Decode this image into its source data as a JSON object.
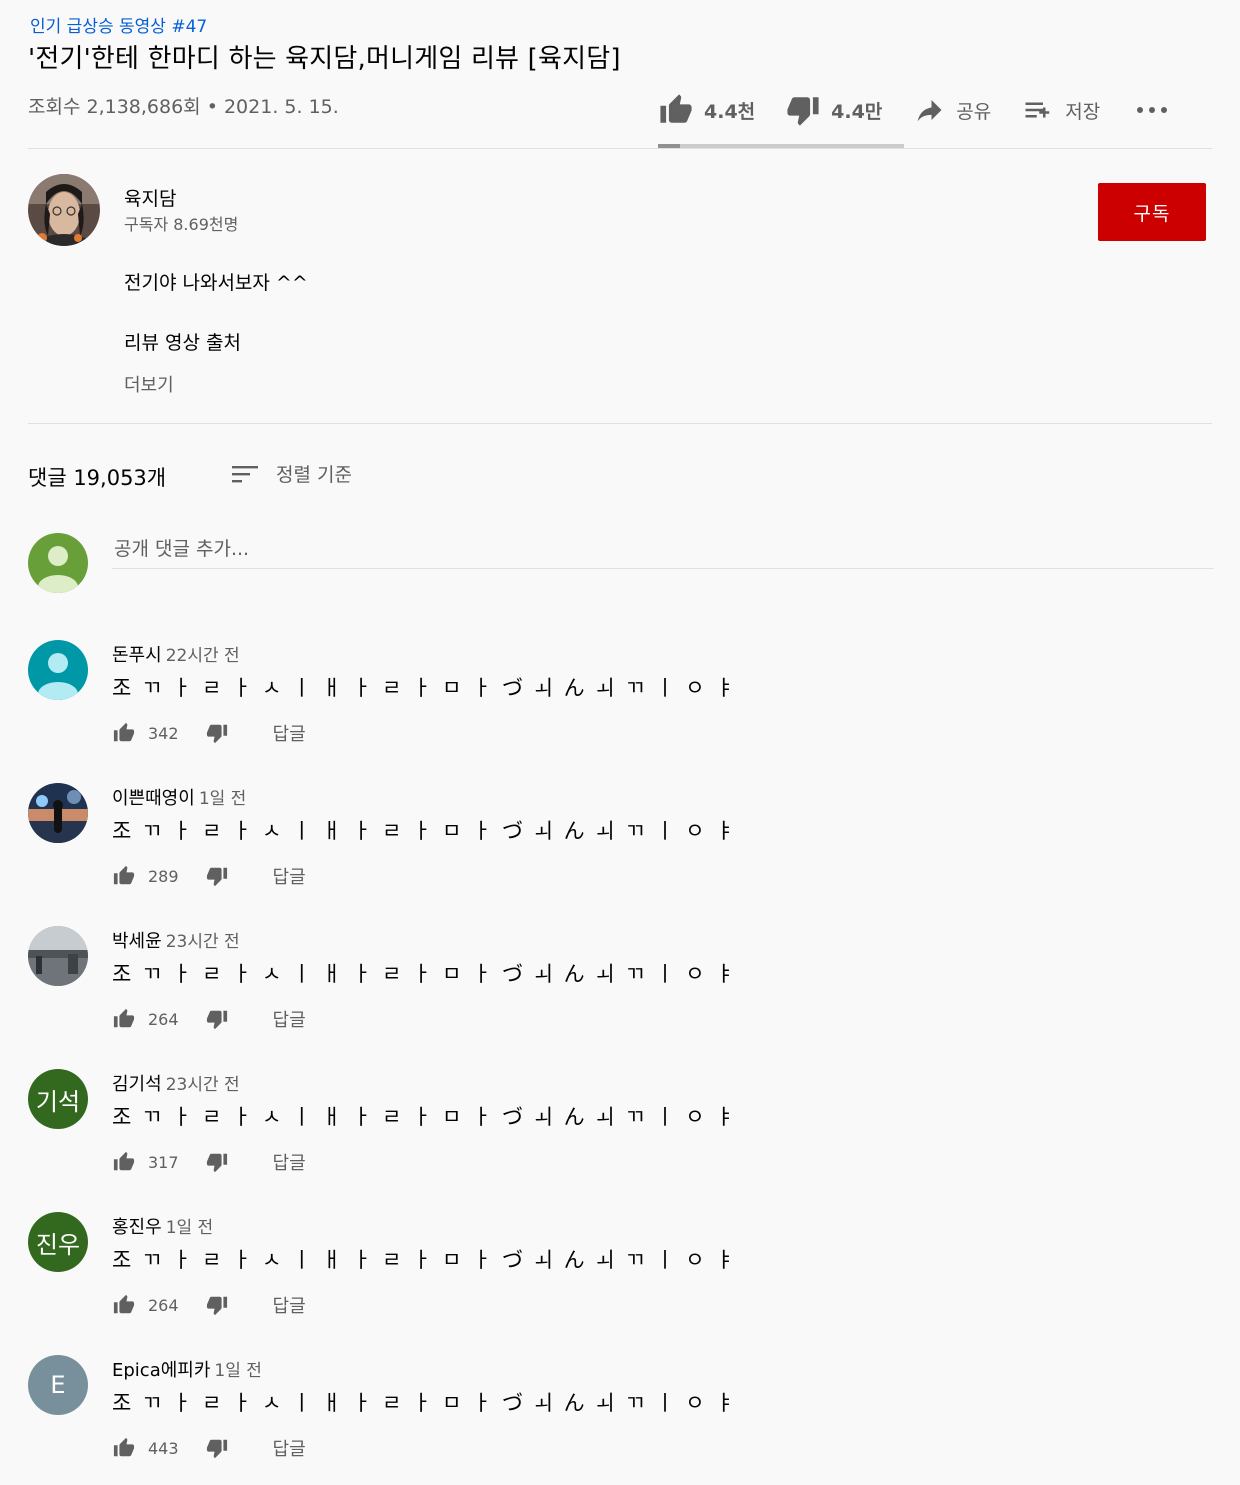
{
  "video": {
    "trending": "인기 급상승 동영상 #47",
    "title": "'전기'한테 한마디 하는 육지담,머니게임 리뷰 [육지담]",
    "views": "조회수 2,138,686회",
    "date": "2021. 5. 15.",
    "likes": "4.4천",
    "dislikes": "4.4만",
    "share_label": "공유",
    "save_label": "저장",
    "like_fraction": 0.09
  },
  "channel": {
    "name": "육지담",
    "subscribers": "구독자 8.69천명",
    "subscribe_label": "구독"
  },
  "description": {
    "line1": "전기야 나와서보자 ^^",
    "line2": "리뷰 영상 출처",
    "more_label": "더보기"
  },
  "comments_section": {
    "count_label": "댓글 19,053개",
    "sort_label": "정렬 기준",
    "add_placeholder": "공개 댓글 추가...",
    "reply_label": "답글"
  },
  "comments": [
    {
      "author": "돈푸시",
      "time": "22시간 전",
      "text": "조 ㄲ ㅏ ㄹ ㅏ ㅅ ㅣ ㅐ ㅏ ㄹ ㅏ ㅁ ㅏ づ ㅚ ん ㅚ ㄲ ㅣ ㅇ ㅑ",
      "likes": "342",
      "avatar": "default-teal",
      "avatar_color": "#0097a7"
    },
    {
      "author": "이쁜때영이",
      "time": "1일 전",
      "text": "조 ㄲ ㅏ ㄹ ㅏ ㅅ ㅣ ㅐ ㅏ ㄹ ㅏ ㅁ ㅏ づ ㅚ ん ㅚ ㄲ ㅣ ㅇ ㅑ",
      "likes": "289",
      "avatar": "photo-sunset",
      "avatar_color": "#3a4a6a"
    },
    {
      "author": "박세윤",
      "time": "23시간 전",
      "text": "조 ㄲ ㅏ ㄹ ㅏ ㅅ ㅣ ㅐ ㅏ ㄹ ㅏ ㅁ ㅏ づ ㅚ ん ㅚ ㄲ ㅣ ㅇ ㅑ",
      "likes": "264",
      "avatar": "photo-street",
      "avatar_color": "#7a7f86"
    },
    {
      "author": "김기석",
      "time": "23시간 전",
      "text": "조 ㄲ ㅏ ㄹ ㅏ ㅅ ㅣ ㅐ ㅏ ㄹ ㅏ ㅁ ㅏ づ ㅚ ん ㅚ ㄲ ㅣ ㅇ ㅑ",
      "likes": "317",
      "avatar": "letters",
      "avatar_text": "기석",
      "avatar_color": "#33691e"
    },
    {
      "author": "홍진우",
      "time": "1일 전",
      "text": "조 ㄲ ㅏ ㄹ ㅏ ㅅ ㅣ ㅐ ㅏ ㄹ ㅏ ㅁ ㅏ づ ㅚ ん ㅚ ㄲ ㅣ ㅇ ㅑ",
      "likes": "264",
      "avatar": "letters",
      "avatar_text": "진우",
      "avatar_color": "#33691e"
    },
    {
      "author": "Epica에피카",
      "time": "1일 전",
      "text": "조 ㄲ ㅏ ㄹ ㅏ ㅅ ㅣ ㅐ ㅏ ㄹ ㅏ ㅁ ㅏ づ ㅚ ん ㅚ ㄲ ㅣ ㅇ ㅑ",
      "likes": "443",
      "avatar": "letters",
      "avatar_text": "E",
      "avatar_color": "#78909c"
    }
  ]
}
